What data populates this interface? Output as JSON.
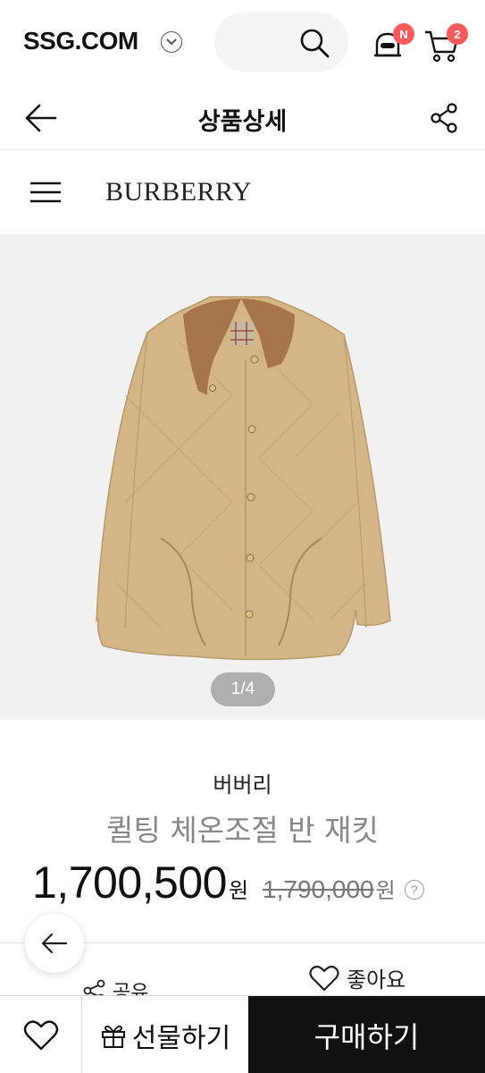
{
  "topbar": {
    "logo": "SSG.COM",
    "notification_badge": "N",
    "cart_count": "2",
    "icons": [
      "chevron-down-icon",
      "search-icon",
      "bell-icon",
      "cart-icon"
    ]
  },
  "header": {
    "title": "상품상세",
    "icons": [
      "back-arrow-icon",
      "share-icon"
    ]
  },
  "brandbar": {
    "brand_logo": "BURBERRY",
    "icons": [
      "hamburger-menu-icon"
    ]
  },
  "gallery": {
    "pager": "1/4",
    "image_subject": "product-photo"
  },
  "product": {
    "brand": "버버리",
    "name": "퀼팅 체온조절 반 재킷",
    "price": "1,700,500",
    "price_unit": "원",
    "original_price": "1,790,000",
    "original_price_unit": "원",
    "help_symbol": "?"
  },
  "actions": {
    "share_label": "공유",
    "like_label": "좋아요"
  },
  "bottombar": {
    "gift_label": "선물하기",
    "buy_label": "구매하기"
  },
  "colors": {
    "badge": "#ff5a5a",
    "buy_button": "#111111",
    "image_background": "#f1f1f1"
  }
}
